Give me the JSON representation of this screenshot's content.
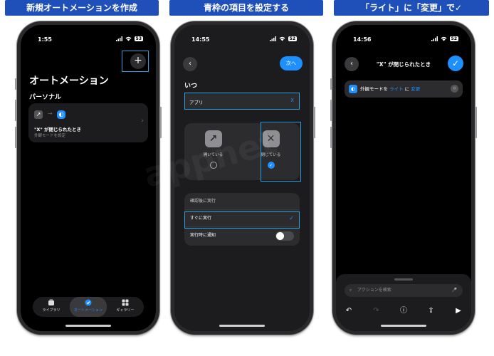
{
  "captions": [
    "新規オートメーションを作成",
    "青枠の項目を設定する",
    "「ライト」に「変更」で✓"
  ],
  "phone1": {
    "time": "1:55",
    "battery": "53",
    "add_label": "+",
    "title": "オートメーション",
    "section": "パーソナル",
    "automation": {
      "name": "\"X\" が閉じられたとき",
      "sub": "外観モードを設定"
    },
    "tabs": [
      {
        "label": "ライブラリ"
      },
      {
        "label": "オートメーション"
      },
      {
        "label": "ギャラリー"
      }
    ]
  },
  "phone2": {
    "time": "14:55",
    "battery": "52",
    "next_label": "次へ",
    "when_label": "いつ",
    "app_label": "アプリ",
    "app_value": "X",
    "options": [
      {
        "label": "開いている"
      },
      {
        "label": "閉じている"
      }
    ],
    "run": [
      {
        "label": "確認後に実行"
      },
      {
        "label": "すぐに実行"
      },
      {
        "label": "実行時に通知"
      }
    ]
  },
  "phone3": {
    "time": "14:56",
    "battery": "52",
    "nav_title": "\"X\" が閉じられたとき",
    "action": {
      "prefix": "外観モードを",
      "mode": "ライト",
      "mid": "に",
      "change": "変更"
    },
    "search_placeholder": "アクションを検索"
  },
  "watermark": "appnet",
  "colors": {
    "accent": "#1e8fff",
    "highlight": "#29a0e0",
    "caption_bg": "#1f4fb8"
  }
}
